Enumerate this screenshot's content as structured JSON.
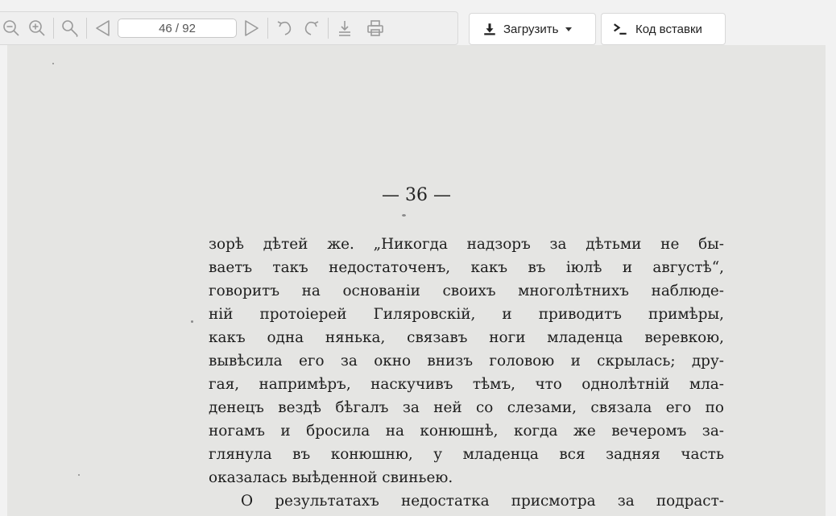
{
  "toolbar": {
    "page_indicator": "46 / 92",
    "icons": [
      "zoom-out-icon",
      "zoom-in-icon",
      "search-icon",
      "prev-page-icon",
      "next-page-icon",
      "rotate-left-icon",
      "rotate-right-icon",
      "download-icon",
      "print-icon"
    ],
    "download_label": "Загрузить",
    "embed_label": "Код вставки"
  },
  "document": {
    "page_number": "— 36 —",
    "lines": [
      "зорѣ дѣтей же. „Никогда надзоръ за дѣтьми не бы-",
      "ваетъ такъ недостаточенъ, какъ въ іюлѣ и августѣ“,",
      "говоритъ на основаніи своихъ многолѣтнихъ наблюде-",
      "ній протоіерей Гиляровскій, и приводитъ примѣры,",
      "какъ одна нянька, связавъ ноги младенца веревкою,",
      "вывѣсила его за окно внизъ головою и скрылась; дру-",
      "гая, напримѣръ, наскучивъ тѣмъ, что однолѣтній мла-",
      "денецъ вездѣ бѣгалъ за ней со слезами, связала его по",
      "ногамъ и бросила на конюшнѣ, когда же вечеромъ за-",
      "глянула въ конюшню, у младенца вся задняя часть",
      "оказалась выѣденной свиньею.",
      "О результатахъ недостатка присмотра за подраст-"
    ]
  },
  "colors": {
    "toolbar_bg": "#f2f2f2",
    "icon": "#9a9a9a",
    "page_bg": "#e5e5e3",
    "text": "#1e1e1e"
  }
}
